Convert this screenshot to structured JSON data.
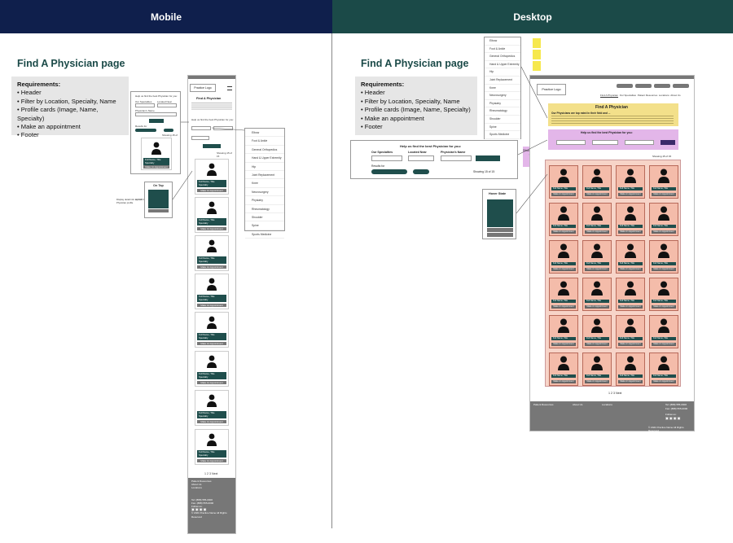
{
  "headers": {
    "mobile": "Mobile",
    "desktop": "Desktop"
  },
  "colors": {
    "mobile_header": "#0f1f4c",
    "desktop_header": "#1b4a48",
    "teal": "#1f4e4c",
    "card_highlight": "#f4bcaa",
    "selected_highlight": "#e3b6e9",
    "note_yellow": "#f6e84d"
  },
  "page_title": "Find A Physician page",
  "requirements": {
    "heading": "Requirements:",
    "items": [
      "• Header",
      "• Filter by Location, Specialty, Name",
      "• Profile cards (Image, Name, Specialty)",
      "• Make an appointment",
      "• Footer"
    ]
  },
  "wire": {
    "practice_logo": "Practice Logo",
    "find_physician": "Find A Physician",
    "intro": "Our Physicians are top rated in their field and ...",
    "help": "Help us find the best Physician for you:",
    "our_specialties": "Our Specialties",
    "located_near": "Located Near",
    "physician_name": "Physician's Name",
    "search": "Search",
    "results_for": "Results for",
    "general_ortho": "General Orthopedics",
    "chip_zip": "12345",
    "showing": "Showing 15 of 15",
    "full_name": "Full Name, Title",
    "specialty": "Specialty",
    "make_appt": "Make An Appointment",
    "pagination": "1 2 3 Next",
    "on_tap": "On Tap",
    "see_full": "See Full Profile",
    "hover_state": "Hover State",
    "show_selected": "Show selected states",
    "nav": [
      "Find A Physician",
      "Our Specialties",
      "Patient Resources",
      "Locations",
      "About Us"
    ],
    "footer": {
      "col1": "Patient Resources",
      "col2": "About Us",
      "col3": "Locations",
      "tel": "Tel: (888) 555-0000",
      "fax": "Fax: (888) 555-0000",
      "follow": "Follow us:",
      "copyright": "© 2021 Practice Name All Rights Reserved"
    }
  },
  "menu_items": [
    "Elbow",
    "Foot & Ankle",
    "General Orthopedics",
    "Hand & Upper Extremity",
    "Hip",
    "Joint Replacement",
    "Knee",
    "Neurosurgery",
    "Physiatry",
    "Rheumatology",
    "Shoulder",
    "Spine",
    "Sports Medicine"
  ]
}
